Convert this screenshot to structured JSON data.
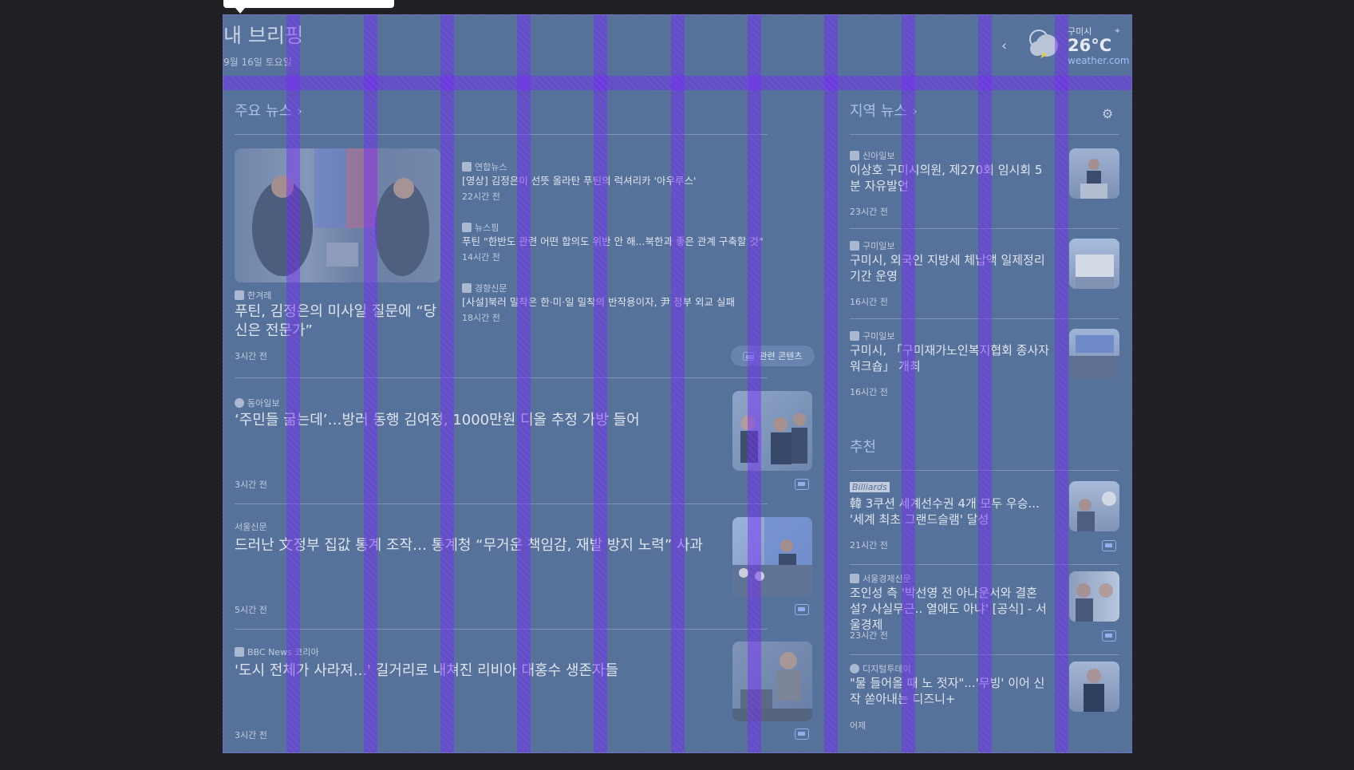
{
  "header": {
    "title": "내 브리핑",
    "date": "9월 16일 토요일"
  },
  "weather": {
    "city": "구미시",
    "temperature": "26°C",
    "source": "weather.com"
  },
  "top_news": {
    "section_title": "주요 뉴스",
    "main": {
      "source": "한겨레",
      "headline": "푸틴, 김정은의 미사일 질문에 “당신은 전문가”",
      "time": "3시간 전"
    },
    "related": [
      {
        "source": "연합뉴스",
        "headline": "[영상] 김정은이 선뜻 올라탄 푸틴의 럭셔리카 '아우루스'",
        "time": "22시간 전"
      },
      {
        "source": "뉴스핌",
        "headline": "푸틴 \"한반도 관련 어떤 합의도 위반 안 해...북한과 좋은 관계 구축할 것\"",
        "time": "14시간 전"
      },
      {
        "source": "경향신문",
        "headline": "[사설]북러 밀착은 한·미·일 밀착의 반작용이자, 尹 정부 외교 실패",
        "time": "18시간 전"
      }
    ],
    "related_button": "관련 콘텐츠",
    "stories": [
      {
        "source": "동아일보",
        "headline": "‘주민들 굶는데’…방러 동행 김여정, 1000만원 디올 추정 가방 들어",
        "time": "3시간 전"
      },
      {
        "source": "서울신문",
        "headline": "드러난 文정부 집값 통계 조작… 통계청 “무거운 책임감, 재발 방지 노력” 사과",
        "time": "5시간 전"
      },
      {
        "source": "BBC News 코리아",
        "headline": "'도시 전체가 사라져...' 길거리로 내쳐진 리비아 대홍수 생존자들",
        "time": "3시간 전"
      }
    ]
  },
  "local_news": {
    "section_title": "지역 뉴스",
    "items": [
      {
        "source": "신아일보",
        "headline": "이상호 구미시의원, 제270회 임시회 5분 자유발언",
        "time": "23시간 전"
      },
      {
        "source": "구미일보",
        "headline": "구미시, 외국인 지방세 체납액 일제정리 기간 운영",
        "time": "16시간 전"
      },
      {
        "source": "구미일보",
        "headline": "구미시, 「구미재가노인복지협회 종사자 워크숍」 개최",
        "time": "16시간 전"
      }
    ]
  },
  "recommended": {
    "section_title": "추천",
    "items": [
      {
        "source": "Billiards",
        "headline": "韓 3쿠션 세계선수권 4개 모두 우승... '세계 최초 그랜드슬램' 달성",
        "time": "21시간 전"
      },
      {
        "source": "서울경제신문",
        "headline": "조인성 측 '박선영 전 아나운서와 결혼설? 사실무근.. 열애도 아냐' [공식] - 서울경제",
        "time": "23시간 전"
      },
      {
        "source": "디지털투데이",
        "headline": "\"물 들어올 때 노 젓자\"...'무빙' 이어 신작 쏟아내는 디즈니+",
        "time": "어제"
      }
    ]
  },
  "colors": {
    "overlay": "#56729a",
    "stripe": "#8034ff",
    "page_bg": "#202124"
  }
}
